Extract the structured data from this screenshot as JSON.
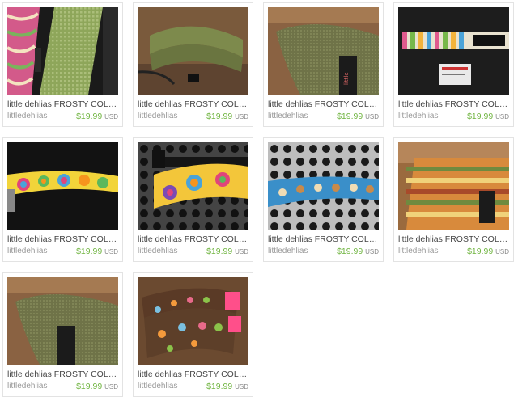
{
  "listings": [
    {
      "title": "little dehlias FROSTY COLLA...",
      "shop": "littledehlias",
      "price": "$19.99",
      "currency": "USD",
      "image": "striped-and-green-cooling-collars"
    },
    {
      "title": "little dehlias FROSTY COLLA...",
      "shop": "littledehlias",
      "price": "$19.99",
      "currency": "USD",
      "image": "olive-collar-with-leash"
    },
    {
      "title": "little dehlias FROSTY COLLA...",
      "shop": "littledehlias",
      "price": "$19.99",
      "currency": "USD",
      "image": "olive-collar-closeup"
    },
    {
      "title": "little dehlias FROSTY COLLA...",
      "shop": "littledehlias",
      "price": "$19.99",
      "currency": "USD",
      "image": "striped-collar-with-buckle"
    },
    {
      "title": "little dehlias FROSTY COLLA...",
      "shop": "littledehlias",
      "price": "$19.99",
      "currency": "USD",
      "image": "rainbow-circles-collar"
    },
    {
      "title": "little dehlias FROSTY COLLA...",
      "shop": "littledehlias",
      "price": "$19.99",
      "currency": "USD",
      "image": "circles-collar-on-grate"
    },
    {
      "title": "little dehlias FROSTY COLLA...",
      "shop": "littledehlias",
      "price": "$19.99",
      "currency": "USD",
      "image": "blue-dog-print-collar"
    },
    {
      "title": "little dehlias FROSTY COLLA...",
      "shop": "littledehlias",
      "price": "$19.99",
      "currency": "USD",
      "image": "orange-stripe-collar"
    },
    {
      "title": "little dehlias FROSTY COLLA...",
      "shop": "littledehlias",
      "price": "$19.99",
      "currency": "USD",
      "image": "olive-collar-closeup-2"
    },
    {
      "title": "little dehlias FROSTY COLLA...",
      "shop": "littledehlias",
      "price": "$19.99",
      "currency": "USD",
      "image": "paw-print-collar-pink-buckle"
    }
  ],
  "colors": {
    "price": "#6fb43f",
    "title": "#444444",
    "shop": "#999999",
    "border": "#e3e3e3"
  }
}
